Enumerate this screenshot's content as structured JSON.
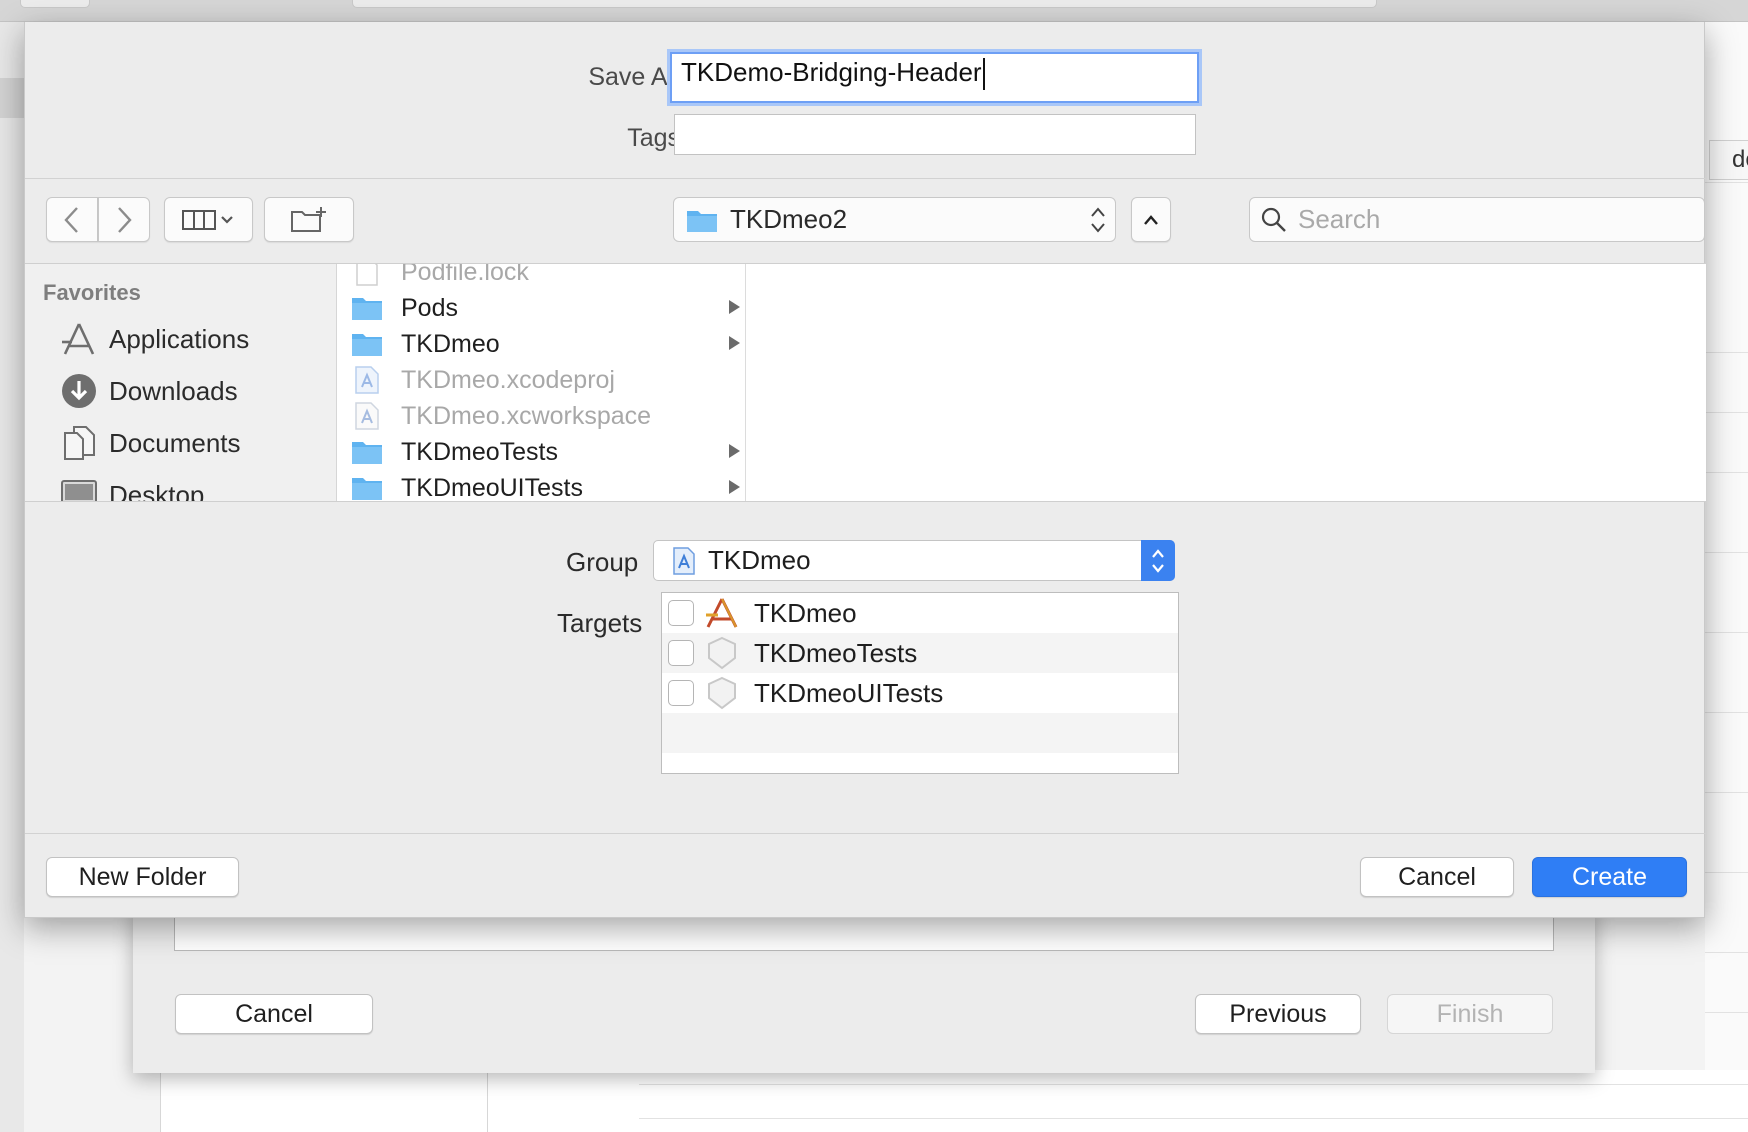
{
  "save_dialog": {
    "save_as_label": "Save As:",
    "save_as_value": "TKDemo-Bridging-Header",
    "tags_label": "Tags:",
    "tags_value": "",
    "location": "TKDmeo2",
    "search_placeholder": "Search",
    "sidebar": {
      "heading": "Favorites",
      "items": [
        {
          "label": "Applications",
          "icon": "applications-icon"
        },
        {
          "label": "Downloads",
          "icon": "downloads-icon"
        },
        {
          "label": "Documents",
          "icon": "documents-icon"
        },
        {
          "label": "Desktop",
          "icon": "desktop-icon"
        }
      ]
    },
    "files": [
      {
        "name": "Podfile.lock",
        "kind": "file",
        "enabled": false
      },
      {
        "name": "Pods",
        "kind": "folder",
        "enabled": true
      },
      {
        "name": "TKDmeo",
        "kind": "folder",
        "enabled": true
      },
      {
        "name": "TKDmeo.xcodeproj",
        "kind": "xcodeproj",
        "enabled": false
      },
      {
        "name": "TKDmeo.xcworkspace",
        "kind": "xcworkspace",
        "enabled": false
      },
      {
        "name": "TKDmeoTests",
        "kind": "folder",
        "enabled": true
      },
      {
        "name": "TKDmeoUITests",
        "kind": "folder",
        "enabled": true
      }
    ],
    "group_label": "Group",
    "group_value": "TKDmeo",
    "targets_label": "Targets",
    "targets": [
      {
        "name": "TKDmeo",
        "checked": false,
        "icon": "app-target-icon"
      },
      {
        "name": "TKDmeoTests",
        "checked": false,
        "icon": "test-target-icon"
      },
      {
        "name": "TKDmeoUITests",
        "checked": false,
        "icon": "test-target-icon"
      }
    ],
    "new_folder_label": "New Folder",
    "cancel_label": "Cancel",
    "create_label": "Create"
  },
  "wizard": {
    "cancel_label": "Cancel",
    "previous_label": "Previous",
    "finish_label": "Finish"
  },
  "background": {
    "right_tab_text": "de"
  },
  "colors": {
    "accent": "#2f7ef5",
    "focus_ring": "#a9c7f8",
    "folder": "#5fb3f0"
  }
}
